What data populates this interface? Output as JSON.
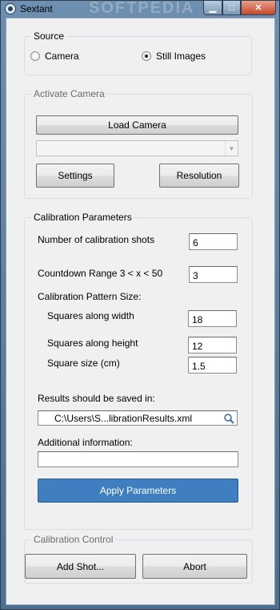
{
  "window": {
    "title": "Sextant",
    "watermark": "SOFTPEDIA"
  },
  "source": {
    "legend": "Source",
    "options": [
      {
        "label": "Camera",
        "checked": false
      },
      {
        "label": "Still Images",
        "checked": true
      }
    ]
  },
  "activate_camera": {
    "legend": "Activate Camera",
    "load_label": "Load Camera",
    "device_value": "",
    "settings_label": "Settings",
    "resolution_label": "Resolution"
  },
  "calibration": {
    "legend": "Calibration Parameters",
    "shots_label": "Number of calibration shots",
    "shots_value": "6",
    "countdown_label": "Countdown Range 3 < x < 50",
    "countdown_value": "3",
    "pattern_label": "Calibration Pattern Size:",
    "width_label": "Squares along width",
    "width_value": "18",
    "height_label": "Squares along height",
    "height_value": "12",
    "size_label": "Square size (cm)",
    "size_value": "1.5",
    "results_label": "Results should be saved in:",
    "results_path": "C:\\Users\\S...librationResults.xml",
    "additional_label": "Additional information:",
    "additional_value": "",
    "apply_label": "Apply Parameters"
  },
  "control": {
    "legend": "Calibration Control",
    "add_label": "Add Shot...",
    "abort_label": "Abort"
  },
  "colors": {
    "primary_button": "#3f7fbf",
    "window_frame": "#5b7a98"
  }
}
